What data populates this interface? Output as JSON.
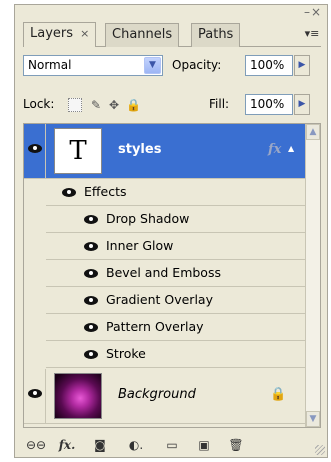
{
  "window": {
    "minimize_glyph": "–",
    "close_glyph": "×"
  },
  "tabs": [
    {
      "label": "Layers",
      "close": "×",
      "active": true
    },
    {
      "label": "Channels",
      "active": false
    },
    {
      "label": "Paths",
      "active": false
    }
  ],
  "flyout_glyph": "▾≡",
  "blend": {
    "value": "Normal",
    "dropdown_glyph": "▼"
  },
  "opacity": {
    "label": "Opacity:",
    "value": "100%",
    "arrow": "▶"
  },
  "lock": {
    "label": "Lock:",
    "icons": [
      "lock-transparent-icon",
      "brush-icon",
      "move-icon",
      "padlock-icon"
    ],
    "glyphs": [
      "",
      "✎",
      "✥",
      "🔒"
    ]
  },
  "fill": {
    "label": "Fill:",
    "value": "100%",
    "arrow": "▶"
  },
  "layers": {
    "type_layer": {
      "name": "styles",
      "thumb_glyph": "T",
      "fx": "fx",
      "toggle": "▲"
    },
    "effects_header": "Effects",
    "effects": [
      "Drop Shadow",
      "Inner Glow",
      "Bevel and Emboss",
      "Gradient Overlay",
      "Pattern Overlay",
      "Stroke"
    ],
    "background_layer": {
      "name": "Background",
      "lock_glyph": "🔒"
    }
  },
  "scrollbar": {
    "up": "▲",
    "down": "▼"
  },
  "toolbar": {
    "icons": [
      "link-icon",
      "fx-icon",
      "mask-icon",
      "adjustment-icon",
      "folder-icon",
      "new-layer-icon",
      "trash-icon"
    ],
    "glyphs": [
      "⊖⊖",
      "fx.",
      "◙",
      "◐.",
      "▭",
      "▣",
      "🗑"
    ]
  },
  "colors": {
    "selection": "#3a6fd1",
    "panel": "#ece9d8"
  }
}
